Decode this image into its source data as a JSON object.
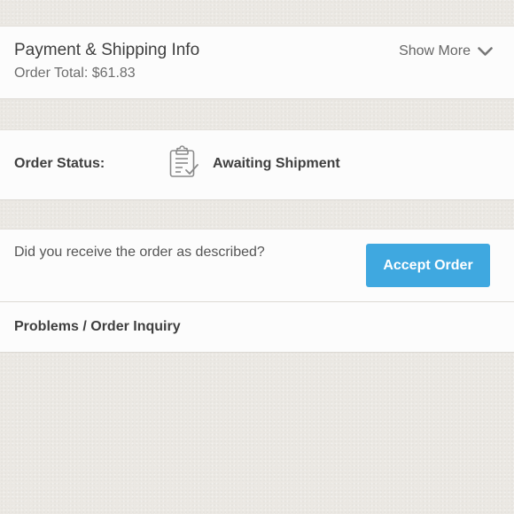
{
  "payment": {
    "title": "Payment & Shipping Info",
    "order_total": "Order Total: $61.83",
    "show_more_label": "Show More"
  },
  "status": {
    "label": "Order Status:",
    "value": "Awaiting Shipment",
    "icon": "clipboard-check-icon"
  },
  "receive": {
    "question": "Did you receive the order as described?",
    "accept_label": "Accept Order",
    "accept_color": "#3fa8e0"
  },
  "inquiry": {
    "label": "Problems / Order Inquiry"
  },
  "colors": {
    "page_background": "#ebe8e3",
    "card_background": "#fcfcfc",
    "text_dark": "#3f3f3f",
    "text_muted": "#6d6d6d"
  }
}
